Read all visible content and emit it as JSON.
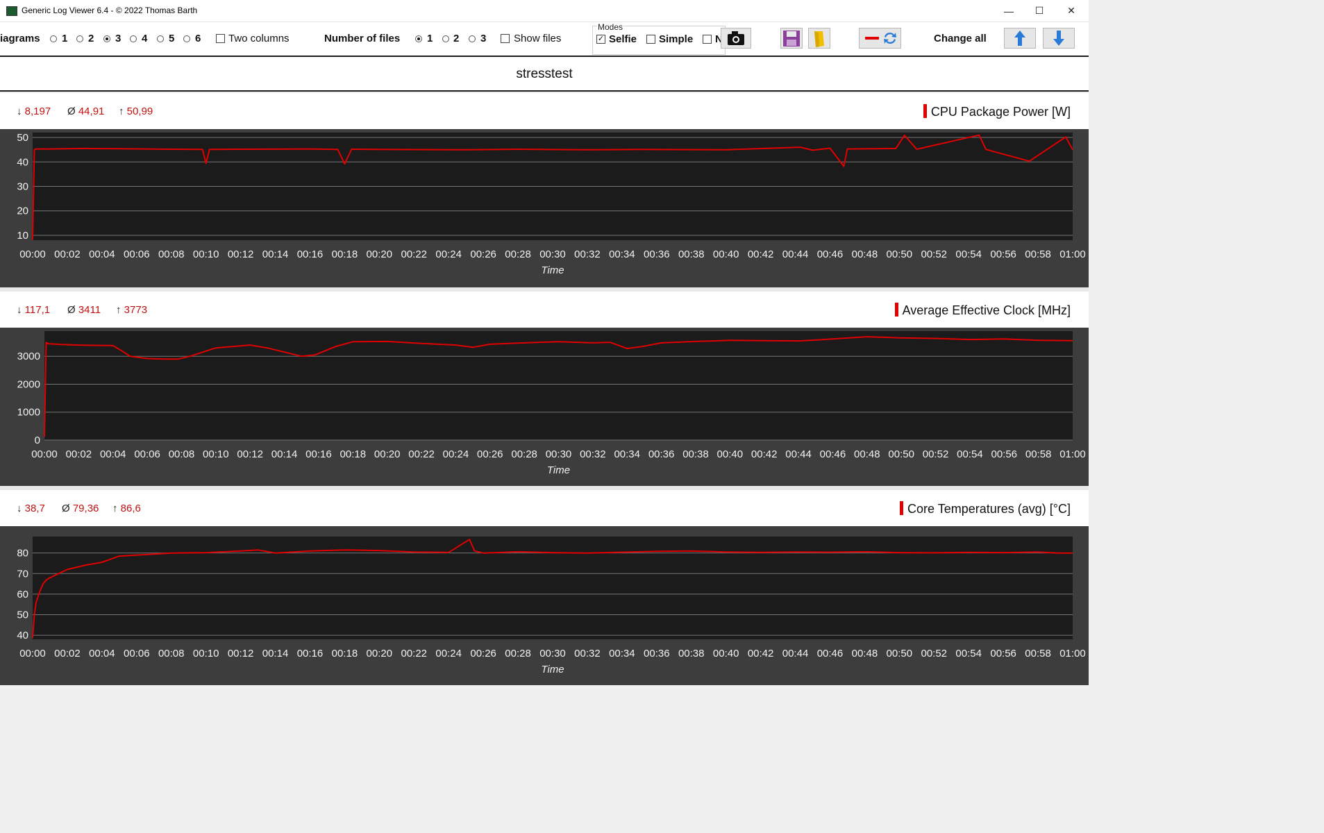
{
  "window": {
    "title": "Generic Log Viewer 6.4 - © 2022 Thomas Barth",
    "minimize": "—",
    "maximize": "☐",
    "close": "✕"
  },
  "toolbar": {
    "diagrams_label": "iagrams",
    "diagram_options": [
      "1",
      "2",
      "3",
      "4",
      "5",
      "6"
    ],
    "diagram_selected": "3",
    "two_columns_label": "Two columns",
    "number_of_files_label": "Number of files",
    "file_options": [
      "1",
      "2",
      "3"
    ],
    "file_selected": "1",
    "show_files_label": "Show files",
    "modes_label": "Modes",
    "selfie_label": "Selfie",
    "selfie_checked": true,
    "simple_label": "Simple",
    "third_mode_label": "N",
    "change_all_label": "Change all",
    "icons": [
      "camera-icon",
      "save-icon",
      "folder-icon",
      "line-color-icon",
      "refresh-icon",
      "arrow-up-icon",
      "arrow-down-icon"
    ]
  },
  "file_name": "stresstest",
  "colors": {
    "series": "#e00000",
    "plot_bg": "#1b1b1b",
    "frame_bg": "#3d3d3d",
    "stat_value": "#c01010"
  },
  "time_ticks": [
    "00:00",
    "00:02",
    "00:04",
    "00:06",
    "00:08",
    "00:10",
    "00:12",
    "00:14",
    "00:16",
    "00:18",
    "00:20",
    "00:22",
    "00:24",
    "00:26",
    "00:28",
    "00:30",
    "00:32",
    "00:34",
    "00:36",
    "00:38",
    "00:40",
    "00:42",
    "00:44",
    "00:46",
    "00:48",
    "00:50",
    "00:52",
    "00:54",
    "00:56",
    "00:58",
    "01:00"
  ],
  "panels": [
    {
      "title": "CPU Package Power [W]",
      "min_symbol": "↓",
      "min": "8,197",
      "avg_symbol": "Ø",
      "avg": "44,91",
      "max_symbol": "↑",
      "max": "50,99",
      "xlabel": "Time"
    },
    {
      "title": "Average Effective Clock [MHz]",
      "min_symbol": "↓",
      "min": "117,1",
      "avg_symbol": "Ø",
      "avg": "3411",
      "max_symbol": "↑",
      "max": "3773",
      "xlabel": "Time"
    },
    {
      "title": "Core Temperatures (avg) [°C]",
      "min_symbol": "↓",
      "min": "38,7",
      "avg_symbol": "Ø",
      "avg": "79,36",
      "max_symbol": "↑",
      "max": "86,6",
      "xlabel": "Time"
    }
  ],
  "chart_data": [
    {
      "type": "line",
      "title": "CPU Package Power [W]",
      "xlabel": "Time",
      "ylabel": "",
      "x_range_minutes": [
        0,
        60
      ],
      "ylim": [
        8,
        52
      ],
      "yticks": [
        10,
        20,
        30,
        40,
        50
      ],
      "series": [
        {
          "name": "CPU Package Power [W]",
          "x": [
            0,
            0.1,
            0.2,
            1,
            3,
            5,
            8,
            9.8,
            10,
            10.2,
            12,
            16,
            17.6,
            18,
            18.4,
            20,
            25,
            28,
            32,
            35,
            40,
            44.3,
            45,
            46,
            46.8,
            47,
            49.8,
            50.3,
            51,
            54.6,
            55,
            57.5,
            59.6,
            60
          ],
          "y": [
            8.2,
            45,
            45.3,
            45.3,
            45.5,
            45.4,
            45.2,
            45.1,
            39.4,
            45.1,
            45.2,
            45.3,
            45.1,
            39.2,
            45.2,
            45.1,
            45,
            45.2,
            45,
            45.1,
            45,
            46,
            44.8,
            45.6,
            38.2,
            45.3,
            45.5,
            50.9,
            45.2,
            50.99,
            45.1,
            40.3,
            50.2,
            45
          ]
        }
      ]
    },
    {
      "type": "line",
      "title": "Average Effective Clock [MHz]",
      "xlabel": "Time",
      "ylabel": "",
      "x_range_minutes": [
        0,
        60
      ],
      "ylim": [
        0,
        3900
      ],
      "yticks": [
        0,
        1000,
        2000,
        3000
      ],
      "series": [
        {
          "name": "Average Effective Clock [MHz]",
          "x": [
            0,
            0.1,
            0.2,
            1,
            2,
            4,
            4.5,
            5,
            6,
            7,
            7.8,
            8.5,
            10,
            11,
            12,
            13,
            14,
            15,
            15.8,
            17,
            18,
            20,
            22,
            24,
            25,
            26,
            28,
            30,
            32,
            33,
            34,
            35,
            36,
            38,
            40,
            42,
            44,
            45,
            46,
            48,
            50,
            52,
            54,
            56,
            58,
            60
          ],
          "y": [
            117,
            3500,
            3450,
            3420,
            3400,
            3380,
            3200,
            3000,
            2920,
            2900,
            2900,
            3000,
            3300,
            3350,
            3400,
            3300,
            3150,
            3000,
            3050,
            3350,
            3520,
            3530,
            3460,
            3400,
            3320,
            3430,
            3480,
            3520,
            3480,
            3500,
            3280,
            3360,
            3480,
            3530,
            3570,
            3560,
            3550,
            3580,
            3620,
            3700,
            3660,
            3640,
            3600,
            3620,
            3570,
            3560
          ]
        }
      ]
    },
    {
      "type": "line",
      "title": "Core Temperatures (avg) [°C]",
      "xlabel": "Time",
      "ylabel": "",
      "x_range_minutes": [
        0,
        60
      ],
      "ylim": [
        38,
        88
      ],
      "yticks": [
        40,
        50,
        60,
        70,
        80
      ],
      "series": [
        {
          "name": "Core Temperatures (avg) [°C]",
          "x": [
            0,
            0.1,
            0.2,
            0.4,
            0.6,
            0.8,
            1,
            1.5,
            2,
            3,
            4,
            4.5,
            5,
            6,
            7,
            8,
            10,
            12,
            13,
            14,
            16,
            18,
            20,
            22,
            24,
            25.2,
            25.5,
            26,
            28,
            30,
            32,
            34,
            36,
            38,
            40,
            42,
            44,
            46,
            48,
            50,
            52,
            54,
            56,
            58,
            59.2,
            60
          ],
          "y": [
            38.7,
            50,
            56,
            61,
            65,
            67,
            68,
            70,
            72,
            74,
            75.5,
            77,
            78.5,
            79,
            79.5,
            80,
            80.2,
            81,
            81.5,
            80,
            81,
            81.5,
            81.2,
            80.5,
            80.3,
            86.6,
            81,
            80,
            80.6,
            80.2,
            80,
            80.4,
            80.8,
            81,
            80.5,
            80.3,
            80.5,
            80.4,
            80.6,
            80.2,
            80.1,
            80.3,
            80.2,
            80.5,
            80,
            80
          ]
        }
      ]
    }
  ]
}
